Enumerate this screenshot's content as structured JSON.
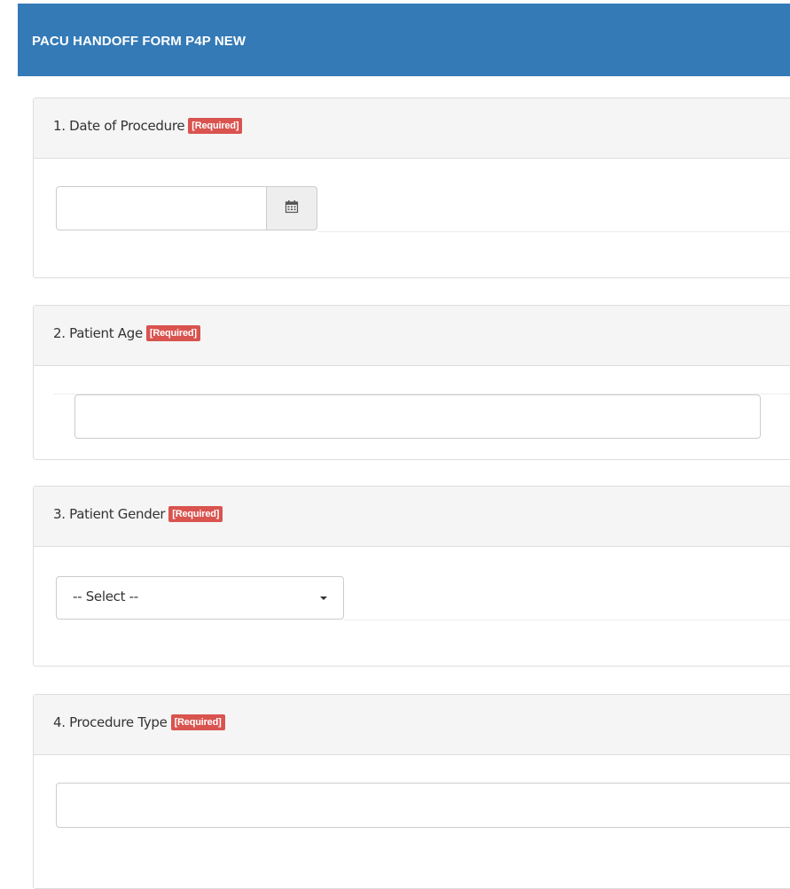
{
  "header": {
    "title": "PACU HANDOFF FORM P4P NEW"
  },
  "questions": [
    {
      "label": "1. Date of Procedure",
      "badge": "[Required]",
      "value": "",
      "icon": "calendar-icon"
    },
    {
      "label": "2. Patient Age",
      "badge": "[Required]",
      "value": ""
    },
    {
      "label": "3. Patient Gender",
      "badge": "[Required]",
      "selected": "-- Select --"
    },
    {
      "label": "4. Procedure Type",
      "badge": "[Required]",
      "value": ""
    }
  ],
  "colors": {
    "header_bg": "#337ab7",
    "badge_bg": "#d9534f",
    "panel_head_bg": "#f5f5f5"
  }
}
